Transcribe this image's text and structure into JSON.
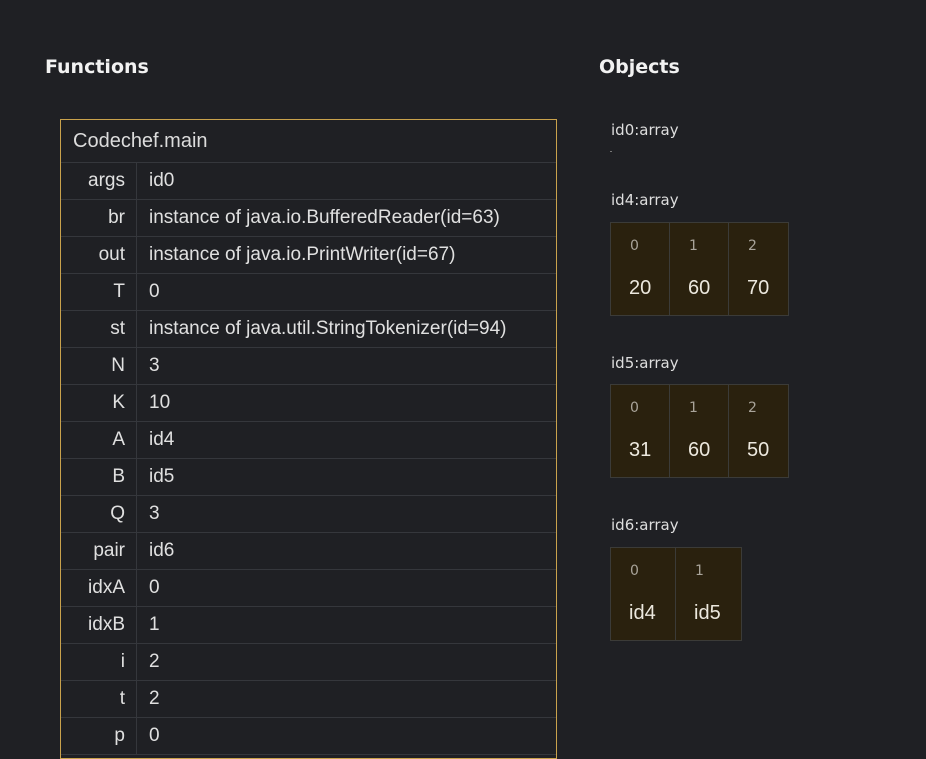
{
  "headings": {
    "functions": "Functions",
    "objects": "Objects"
  },
  "frame": {
    "title": "Codechef.main",
    "vars": [
      {
        "name": "args",
        "value": "id0"
      },
      {
        "name": "br",
        "value": "instance of java.io.BufferedReader(id=63)"
      },
      {
        "name": "out",
        "value": "instance of java.io.PrintWriter(id=67)"
      },
      {
        "name": "T",
        "value": "0"
      },
      {
        "name": "st",
        "value": "instance of java.util.StringTokenizer(id=94)"
      },
      {
        "name": "N",
        "value": "3"
      },
      {
        "name": "K",
        "value": "10"
      },
      {
        "name": "A",
        "value": "id4"
      },
      {
        "name": "B",
        "value": "id5"
      },
      {
        "name": "Q",
        "value": "3"
      },
      {
        "name": "pair",
        "value": "id6"
      },
      {
        "name": "idxA",
        "value": "0"
      },
      {
        "name": "idxB",
        "value": "1"
      },
      {
        "name": "i",
        "value": "2"
      },
      {
        "name": "t",
        "value": "2"
      },
      {
        "name": "p",
        "value": "0"
      }
    ]
  },
  "objects": [
    {
      "label": "id0:array",
      "cells": []
    },
    {
      "label": "id4:array",
      "cells": [
        {
          "index": "0",
          "value": "20"
        },
        {
          "index": "1",
          "value": "60"
        },
        {
          "index": "2",
          "value": "70"
        }
      ]
    },
    {
      "label": "id5:array",
      "cells": [
        {
          "index": "0",
          "value": "31"
        },
        {
          "index": "1",
          "value": "60"
        },
        {
          "index": "2",
          "value": "50"
        }
      ]
    },
    {
      "label": "id6:array",
      "cells": [
        {
          "index": "0",
          "value": "id4"
        },
        {
          "index": "1",
          "value": "id5"
        }
      ]
    }
  ],
  "colors": {
    "background": "#1f2024",
    "frame_border": "#c9a24c",
    "array_cell": "#2a210e"
  }
}
